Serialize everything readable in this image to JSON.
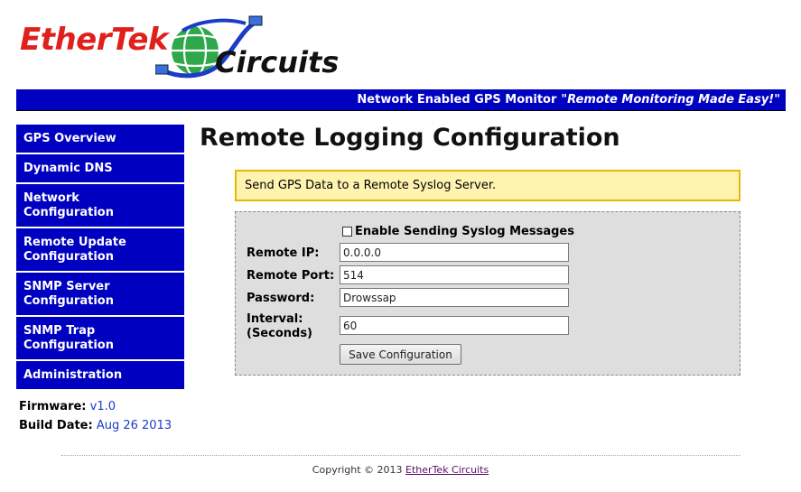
{
  "logo": {
    "part1": "EtherTek",
    "part2": "Circuits"
  },
  "banner": {
    "product": "Network Enabled GPS Monitor",
    "tagline": "\"Remote Monitoring Made Easy!\""
  },
  "sidebar": {
    "items": [
      {
        "line1": "GPS Overview",
        "line2": ""
      },
      {
        "line1": "Dynamic DNS",
        "line2": ""
      },
      {
        "line1": "Network",
        "line2": "Configuration"
      },
      {
        "line1": "Remote Update",
        "line2": "Configuration"
      },
      {
        "line1": "SNMP Server",
        "line2": "Configuration"
      },
      {
        "line1": "SNMP Trap",
        "line2": "Configuration"
      },
      {
        "line1": "Administration",
        "line2": ""
      }
    ],
    "firmware_label": "Firmware:",
    "firmware_value": "v1.0",
    "build_label": "Build Date:",
    "build_value": "Aug 26 2013"
  },
  "main": {
    "title": "Remote Logging Configuration",
    "notice": "Send GPS Data to a Remote Syslog Server.",
    "form": {
      "enable_label": "Enable Sending Syslog Messages",
      "enable_checked": false,
      "remote_ip_label": "Remote IP:",
      "remote_ip_value": "0.0.0.0",
      "remote_port_label": "Remote Port:",
      "remote_port_value": "514",
      "password_label": "Password:",
      "password_value": "Drowssap",
      "interval_label_1": "Interval:",
      "interval_label_2": "(Seconds)",
      "interval_value": "60",
      "save_label": "Save Configuration"
    }
  },
  "footer": {
    "copyright": "Copyright © 2013",
    "link": "EtherTek Circuits"
  },
  "colors": {
    "nav_blue": "#0000c0",
    "notice_bg": "#fff3b0",
    "notice_border": "#e6b800",
    "brand_red": "#e0201c"
  }
}
